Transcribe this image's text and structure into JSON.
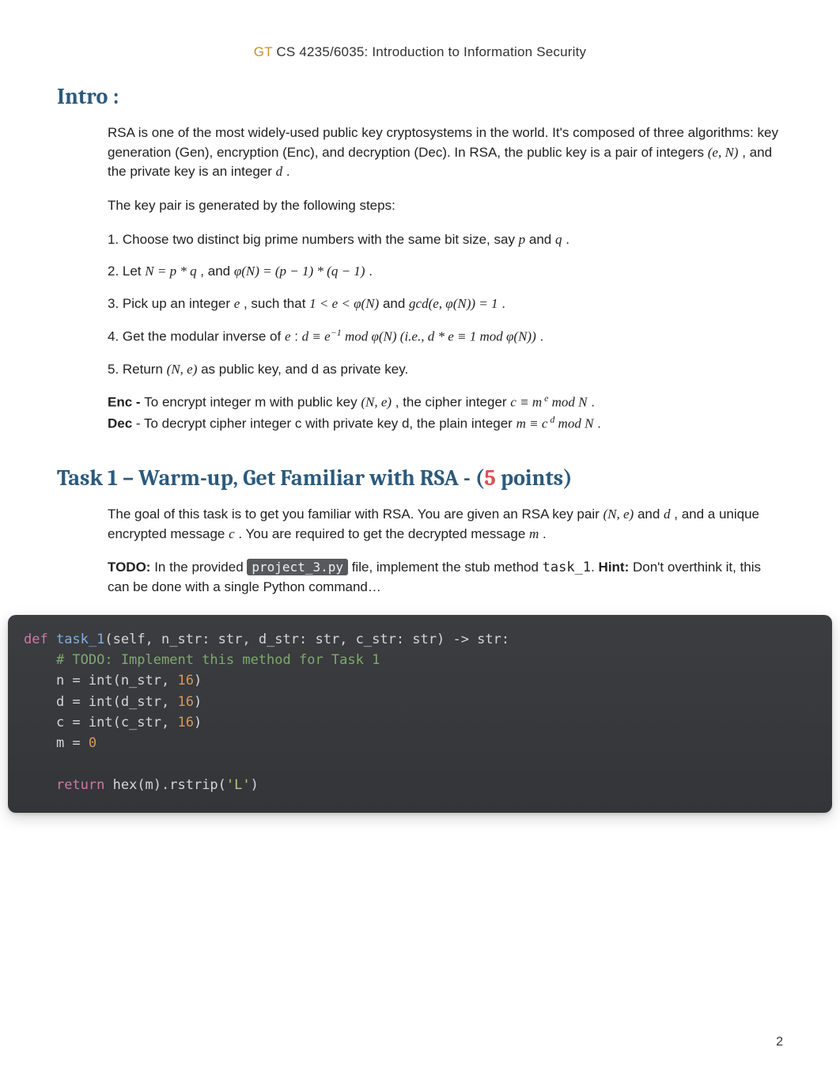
{
  "header": {
    "gt": "GT",
    "course": " CS 4235/6035: Introduction to Information Security"
  },
  "intro": {
    "title": "Intro :",
    "p1_a": "RSA is one of the most widely-used public key cryptosystems in the world. It's composed of three algorithms: key generation (Gen), encryption (Enc), and decryption (Dec). In RSA, the public key is a pair of integers ",
    "p1_math": "(e, N)",
    "p1_b": " , and the private key is an integer ",
    "p1_d": "d",
    "p1_c": " .",
    "p2": "The key pair is generated by the following steps:",
    "s1_a": "1. Choose two distinct big prime numbers with the same bit size, say ",
    "s1_p": "p",
    "s1_and": " and ",
    "s1_q": "q",
    "s1_end": " .",
    "s2_a": "2. Let ",
    "s2_m1": "N = p * q",
    "s2_b": " , and ",
    "s2_m2": "φ(N) = (p − 1) * (q − 1)",
    "s2_end": " .",
    "s3_a": "3. Pick up an integer ",
    "s3_e": "e",
    "s3_b": " , such that ",
    "s3_m1": "1  < e < φ(N)",
    "s3_c": " and ",
    "s3_m2": "gcd(e, φ(N)) = 1",
    "s3_end": " .",
    "s4_a": "4. Get the modular inverse of ",
    "s4_e": "e",
    "s4_colon": " :  ",
    "s4_m1": "d ≡ e",
    "s4_exp": "−1",
    "s4_m2": " mod φ(N) (i.e., d * e ≡ 1 mod φ(N))",
    "s4_end": " .",
    "s5_a": "5. Return ",
    "s5_m": "(N, e)",
    "s5_b": " as public key, and d as private key.",
    "enc_label": "Enc - ",
    "enc_a": "To encrypt integer m with public key ",
    "enc_m1": "(N, e)",
    "enc_b": " , the cipher integer ",
    "enc_m2": "c ≡ m",
    "enc_exp": " e",
    "enc_m3": " mod N",
    "enc_end": " .",
    "dec_label": "Dec",
    "dec_a": " - To decrypt cipher integer c with private key d, the plain integer ",
    "dec_m1": "m ≡ c",
    "dec_exp": " d",
    "dec_m2": " mod N",
    "dec_end": " ."
  },
  "task1": {
    "title_a": "Task 1 – Warm-up, Get Familiar with RSA - (",
    "points": "5",
    "title_b": " points)",
    "p1_a": "The goal of this task is to get you familiar with RSA. You are given an RSA key pair ",
    "p1_m1": "(N, e)",
    "p1_b": " and ",
    "p1_d": "d",
    "p1_c": " , and a unique encrypted message  ",
    "p1_cvar": "c",
    "p1_d2": " . You are required to get the decrypted message ",
    "p1_m": "m",
    "p1_end": " .",
    "todo_label": "TODO:",
    "todo_a": " In the provided ",
    "file1": "project_3.py",
    "todo_b": " file, implement the stub method ",
    "file2": "task_1",
    "todo_c": ". ",
    "hint_label": "Hint:",
    "hint_a": " Don't overthink it, this can be done with a single Python command…"
  },
  "code": {
    "l1_def": "def",
    "l1_fn": " task_1",
    "l1_sig": "(self, n_str: str, d_str: str, c_str: str) -> str:",
    "l2": "    # TODO: Implement this method for Task 1",
    "l3a": "    n = int(n_str, ",
    "l3n": "16",
    "l3b": ")",
    "l4a": "    d = int(d_str, ",
    "l4n": "16",
    "l4b": ")",
    "l5a": "    c = int(c_str, ",
    "l5n": "16",
    "l5b": ")",
    "l6a": "    m = ",
    "l6n": "0",
    "l7": "",
    "l8a": "    ",
    "l8kw": "return",
    "l8b": " hex(m).rstrip(",
    "l8s": "'L'",
    "l8c": ")"
  },
  "page_num": "2"
}
